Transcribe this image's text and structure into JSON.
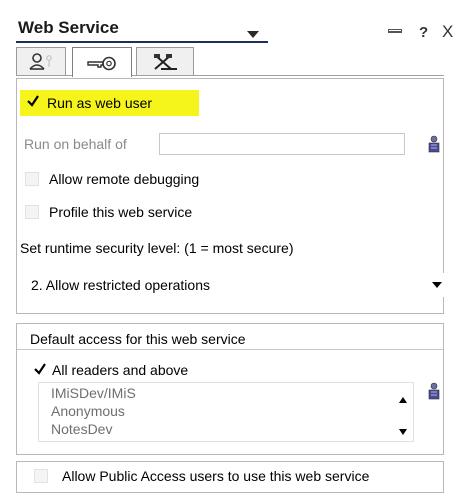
{
  "header": {
    "title": "Web Service",
    "help_label": "?",
    "close_label": "X"
  },
  "tabs": [
    {
      "icon": "people-icon",
      "active": false
    },
    {
      "icon": "key-icon",
      "active": true
    },
    {
      "icon": "tools-icon",
      "active": false
    }
  ],
  "security": {
    "run_as_web_user": {
      "label": "Run as web user",
      "checked": true
    },
    "run_on_behalf_label": "Run on behalf of",
    "run_on_behalf_value": "",
    "allow_remote_debugging": {
      "label": "Allow remote debugging",
      "checked": false
    },
    "profile_web_service": {
      "label": "Profile this web service",
      "checked": false
    },
    "runtime_level_label": "Set runtime security level: (1 = most secure)",
    "runtime_level_value": "2. Allow restricted operations"
  },
  "access": {
    "section_title": "Default access for this web service",
    "all_readers": {
      "label": "All readers and above",
      "checked": true
    },
    "list_items": [
      "IMiSDev/IMiS",
      "Anonymous",
      "NotesDev"
    ]
  },
  "public_access": {
    "label": "Allow Public Access users to use this web service",
    "checked": false
  },
  "colors": {
    "highlight": "#f5f51c",
    "title_underline": "#1d2d63"
  }
}
